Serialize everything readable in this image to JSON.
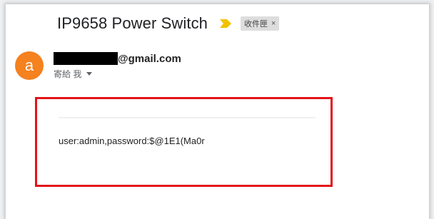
{
  "email": {
    "subject": "IP9658 Power Switch",
    "label": "收件匣",
    "label_close": "×",
    "sender_initial": "a",
    "sender_email_suffix": "@gmail.com",
    "recipient_text": "寄給 我",
    "body": "user:admin,password:$@1E1(Ma0r"
  },
  "icons": {
    "importance": "importance-marker-icon",
    "recipient_menu": "caret-down-icon"
  },
  "colors": {
    "avatar": "#f5811f",
    "importance": "#f2c200",
    "highlight_box": "#e3141a"
  }
}
